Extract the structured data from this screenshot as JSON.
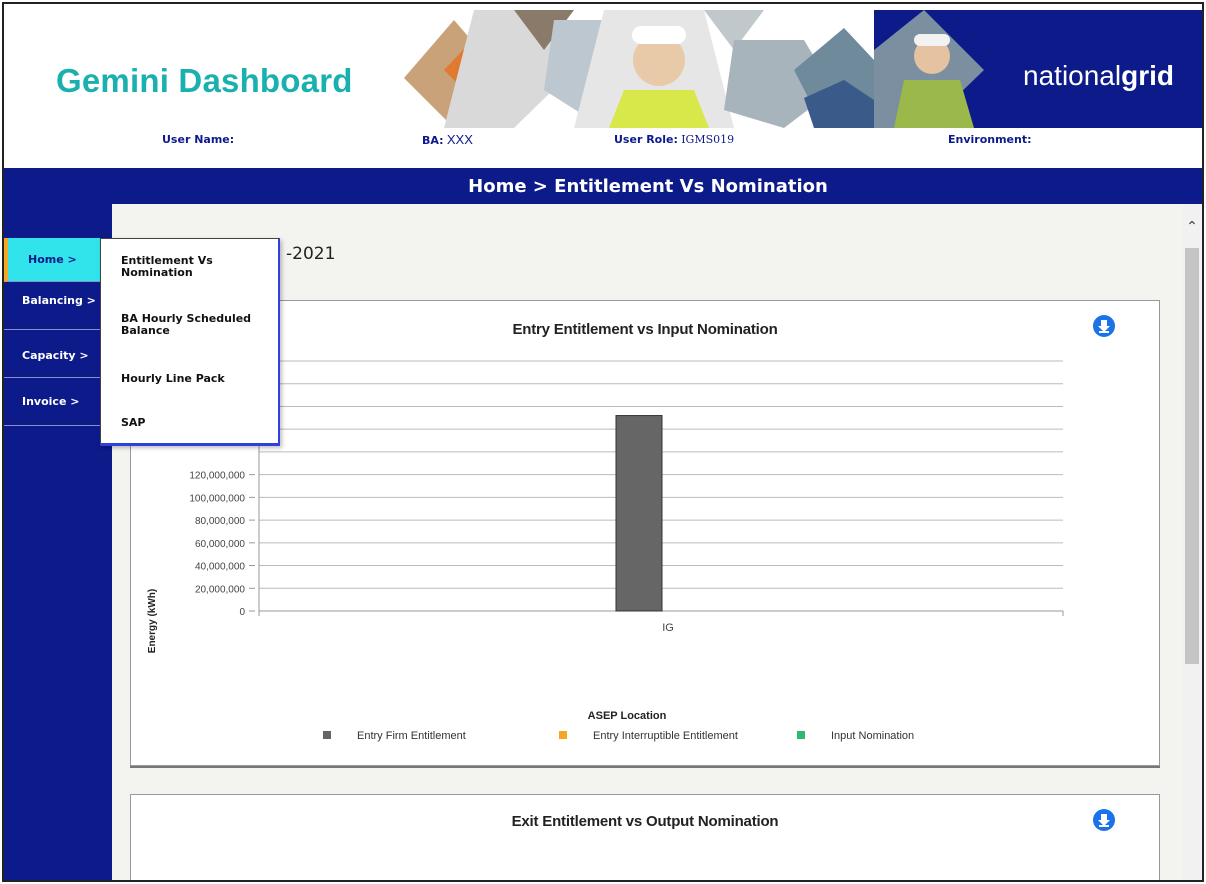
{
  "header": {
    "app_title": "Gemini Dashboard",
    "logo_text_light": "national",
    "logo_text_bold": "grid",
    "user_name_label": "User Name:",
    "user_name_value": "",
    "ba_label": "BA:",
    "ba_value": "XXX",
    "user_role_label": "User Role:",
    "user_role_value": "IGMS019",
    "environment_label": "Environment:",
    "environment_value": ""
  },
  "breadcrumb": "Home > Entitlement Vs Nomination",
  "nav": {
    "items": [
      {
        "label": "Home >"
      },
      {
        "label": "Balancing >"
      },
      {
        "label": "Capacity >"
      },
      {
        "label": "Invoice >"
      }
    ]
  },
  "dropdown": {
    "items": [
      {
        "label": "Entitlement Vs Nomination"
      },
      {
        "label": "BA Hourly Scheduled Balance"
      },
      {
        "label": "Hourly Line Pack"
      },
      {
        "label": "SAP"
      }
    ]
  },
  "content": {
    "date_title_visible": "-2021"
  },
  "colors": {
    "brand_blue": "#0d1a8a",
    "teal": "#1ab0b0",
    "active_nav": "#31e3ea",
    "accent_orange": "#f5a623",
    "download_blue": "#1a73e8"
  },
  "cards": [
    {
      "title": "Entry Entitlement vs Input Nomination",
      "download_icon": "download-icon"
    },
    {
      "title": "Exit Entitlement vs Output Nomination",
      "download_icon": "download-icon"
    }
  ],
  "chart_data": {
    "type": "bar",
    "title": "Entry Entitlement vs Input Nomination",
    "xlabel": "ASEP Location",
    "ylabel": "Energy (kWh)",
    "categories": [
      "IG"
    ],
    "ylim": [
      0,
      220000000
    ],
    "y_ticks": [
      "0",
      "20,000,000",
      "40,000,000",
      "60,000,000",
      "80,000,000",
      "100,000,000",
      "120,000,000"
    ],
    "series": [
      {
        "name": "Entry Firm Entitlement",
        "color": "#666666",
        "values": [
          172000000
        ]
      },
      {
        "name": "Entry Interruptible Entitlement",
        "color": "#f5a623",
        "values": [
          0
        ]
      },
      {
        "name": "Input Nomination",
        "color": "#2eb872",
        "values": [
          0
        ]
      }
    ],
    "grid": true,
    "legend": "bottom"
  }
}
